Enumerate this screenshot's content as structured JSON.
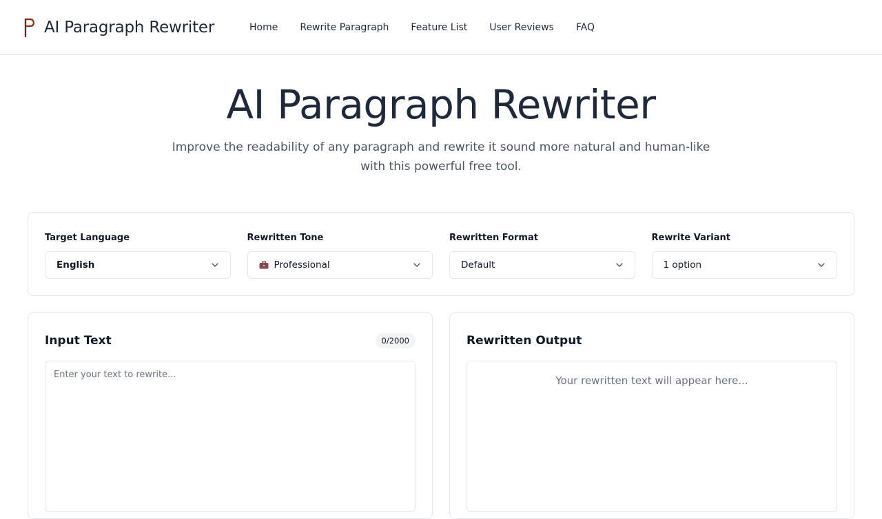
{
  "header": {
    "brand_title": "AI Paragraph Rewriter",
    "logo_icon": "p-logo-icon",
    "nav": [
      {
        "label": "Home"
      },
      {
        "label": "Rewrite Paragraph"
      },
      {
        "label": "Feature List"
      },
      {
        "label": "User Reviews"
      },
      {
        "label": "FAQ"
      }
    ]
  },
  "hero": {
    "title": "AI Paragraph Rewriter",
    "subtitle": "Improve the readability of any paragraph and rewrite it sound more natural and human-like with this powerful free tool."
  },
  "options": [
    {
      "label": "Target Language",
      "value": "English",
      "icon": null
    },
    {
      "label": "Rewritten Tone",
      "value": "Professional",
      "icon": "briefcase-icon"
    },
    {
      "label": "Rewritten Format",
      "value": "Default",
      "icon": null
    },
    {
      "label": "Rewrite Variant",
      "value": "1 option",
      "icon": null
    }
  ],
  "input_panel": {
    "title": "Input Text",
    "counter": "0/2000",
    "placeholder": "Enter your text to rewrite...",
    "value": ""
  },
  "output_panel": {
    "title": "Rewritten Output",
    "placeholder": "Your rewritten text will appear here..."
  },
  "colors": {
    "text_dark": "#1e293b",
    "border": "#e5e7eb",
    "logo_brown": "#8b3a1e",
    "muted": "#6b7280"
  }
}
